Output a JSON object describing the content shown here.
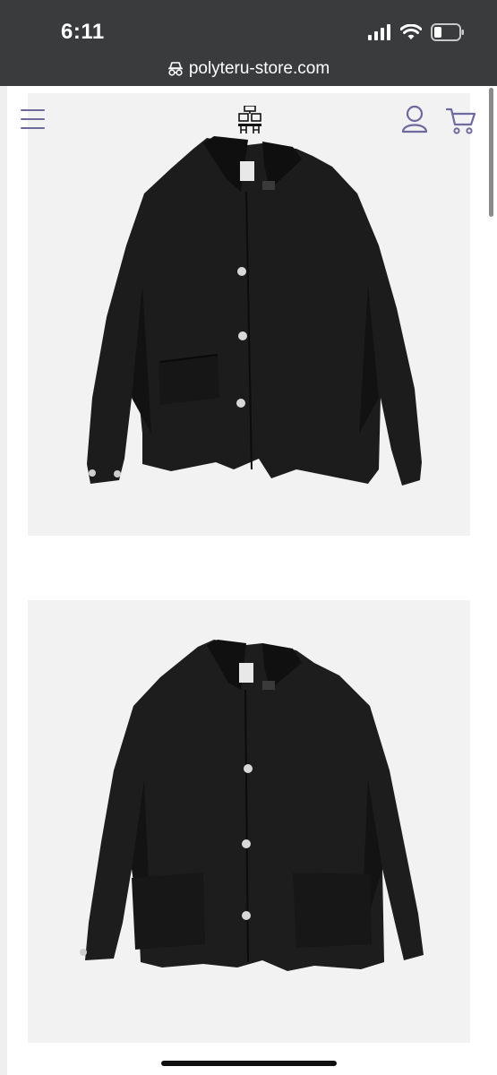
{
  "status_bar": {
    "time": "6:11",
    "icons": [
      "signal-icon",
      "wifi-icon",
      "battery-icon"
    ]
  },
  "browser": {
    "url": "polyteru-store.com",
    "url_icon": "incognito-icon"
  },
  "header": {
    "menu_icon": "hamburger-menu-icon",
    "logo_icon": "store-logo-icon",
    "account_icon": "account-icon",
    "cart_icon": "cart-icon",
    "icon_color": "#6e6a9e"
  },
  "gallery": {
    "images": [
      {
        "alt": "black jacket front view"
      },
      {
        "alt": "black jacket front view, open"
      }
    ]
  }
}
